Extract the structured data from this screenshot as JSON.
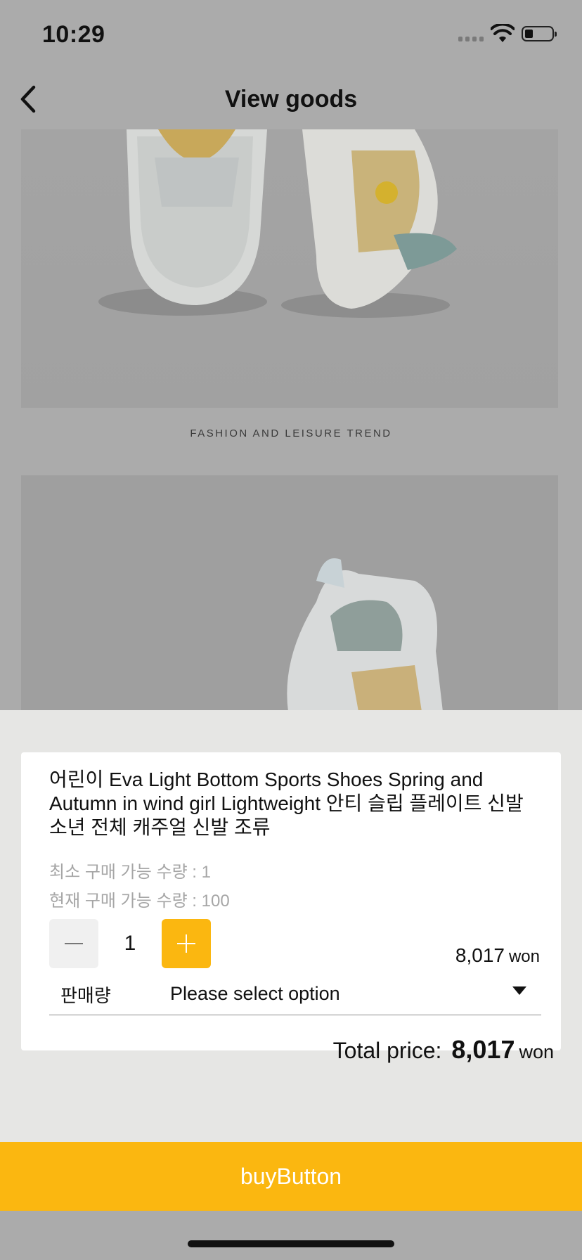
{
  "status_bar": {
    "time": "10:29"
  },
  "nav": {
    "title": "View goods"
  },
  "content": {
    "caption": "FASHION AND LEISURE TREND"
  },
  "product": {
    "name": "어린이 Eva Light Bottom Sports Shoes Spring and Autumn in wind girl Lightweight 안티 슬립 플레이트 신발 소년 전체 캐주얼 신발 조류",
    "min_qty_text": "최소 구매 가능 수량 : 1",
    "current_qty_text": "현재 구매 가능 수량 : 100",
    "quantity": "1",
    "unit_price": "8,017",
    "currency": "won",
    "option_label": "판매량",
    "option_value": "Please select option"
  },
  "total": {
    "label": "Total price:",
    "amount": "8,017",
    "currency": "won"
  },
  "buy_button_label": "buyButton",
  "colors": {
    "accent": "#fbb710",
    "sheet_bg": "#e6e6e4",
    "overlay_bg": "#ababab"
  },
  "icons": [
    "signal-icon",
    "wifi-icon",
    "battery-icon",
    "back-chevron-icon",
    "minus-icon",
    "plus-icon",
    "dropdown-triangle-icon"
  ]
}
